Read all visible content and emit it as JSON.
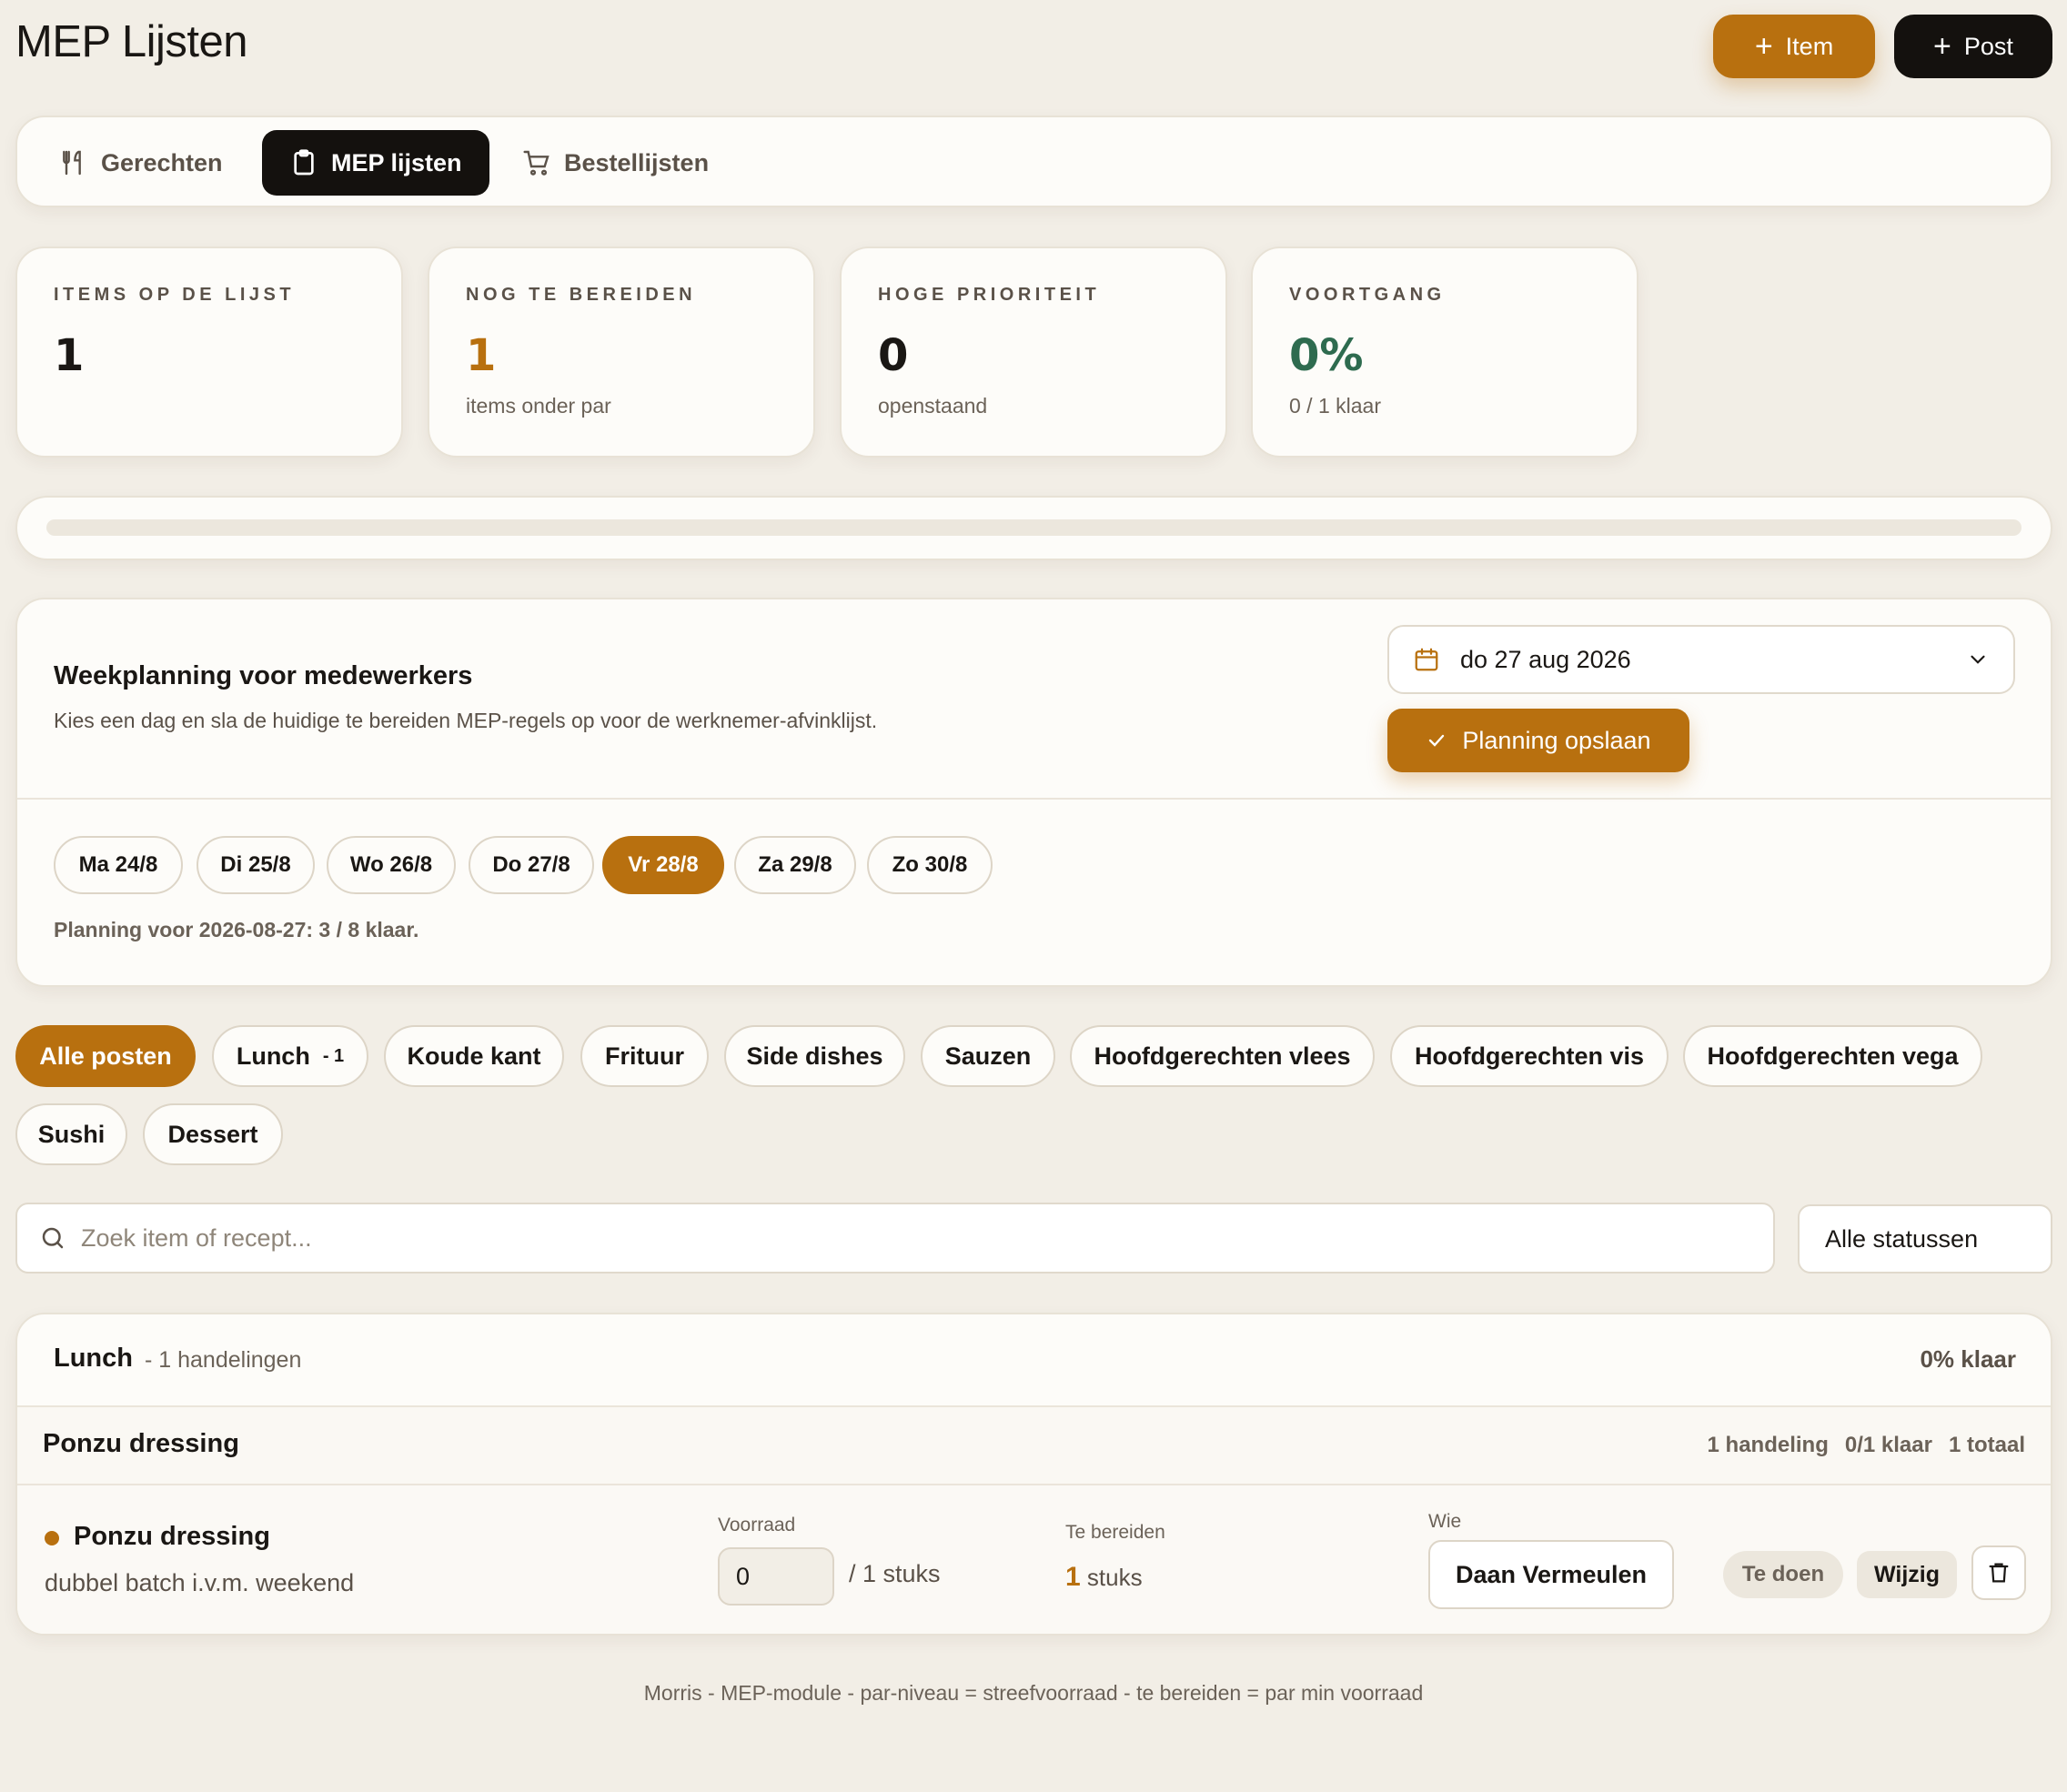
{
  "header": {
    "title": "MEP Lijsten",
    "item_button": "Item",
    "post_button": "Post"
  },
  "tabs": [
    {
      "label": "Gerechten",
      "icon": "utensils-icon",
      "active": false
    },
    {
      "label": "MEP lijsten",
      "icon": "clipboard-icon",
      "active": true
    },
    {
      "label": "Bestellijsten",
      "icon": "cart-icon",
      "active": false
    }
  ],
  "stats": [
    {
      "label": "ITEMS OP DE LIJST",
      "value": "1",
      "sub": "",
      "color": "#1a1714"
    },
    {
      "label": "NOG TE BEREIDEN",
      "value": "1",
      "sub": "items onder par",
      "color": "#b8700f"
    },
    {
      "label": "HOGE PRIORITEIT",
      "value": "0",
      "sub": "openstaand",
      "color": "#1a1714"
    },
    {
      "label": "VOORTGANG",
      "value": "0%",
      "sub": "0 / 1 klaar",
      "color": "#2e6b4f"
    }
  ],
  "progress": {
    "fraction": 0
  },
  "weekplanning": {
    "title": "Weekplanning voor medewerkers",
    "description": "Kies een dag en sla de huidige te bereiden MEP-regels op voor de werknemer-afvinklijst.",
    "selected_date": "do 27 aug 2026",
    "save_button": "Planning opslaan",
    "days": [
      {
        "label": "Ma 24/8",
        "active": false
      },
      {
        "label": "Di 25/8",
        "active": false
      },
      {
        "label": "Wo 26/8",
        "active": false
      },
      {
        "label": "Do 27/8",
        "active": false
      },
      {
        "label": "Vr 28/8",
        "active": true
      },
      {
        "label": "Za 29/8",
        "active": false
      },
      {
        "label": "Zo 30/8",
        "active": false
      }
    ],
    "status": "Planning voor 2026-08-27: 3 / 8 klaar."
  },
  "categories": [
    {
      "label": "Alle posten",
      "count": "",
      "active": true
    },
    {
      "label": "Lunch",
      "count": "- 1",
      "active": false
    },
    {
      "label": "Koude kant",
      "count": "",
      "active": false
    },
    {
      "label": "Frituur",
      "count": "",
      "active": false
    },
    {
      "label": "Side dishes",
      "count": "",
      "active": false
    },
    {
      "label": "Sauzen",
      "count": "",
      "active": false
    },
    {
      "label": "Hoofdgerechten vlees",
      "count": "",
      "active": false
    },
    {
      "label": "Hoofdgerechten vis",
      "count": "",
      "active": false
    },
    {
      "label": "Hoofdgerechten vega",
      "count": "",
      "active": false
    },
    {
      "label": "Sushi",
      "count": "",
      "active": false
    },
    {
      "label": "Dessert",
      "count": "",
      "active": false
    }
  ],
  "search": {
    "placeholder": "Zoek item of recept...",
    "value": ""
  },
  "status_filter": {
    "selected": "Alle statussen"
  },
  "group": {
    "name": "Lunch",
    "meta": "- 1 handelingen",
    "percent": "0% klaar",
    "subgroup": {
      "name": "Ponzu dressing",
      "handeling": "1 handeling",
      "klaar": "0/1 klaar",
      "totaal": "1 totaal"
    },
    "item": {
      "name": "Ponzu dressing",
      "note": "dubbel batch i.v.m. weekend",
      "voorraad_label": "Voorraad",
      "voorraad_value": "0",
      "voorraad_total": "/ 1 stuks",
      "prep_label": "Te bereiden",
      "prep_value": "1",
      "prep_unit": "stuks",
      "who_label": "Wie",
      "who_value": "Daan Vermeulen",
      "status": "Te doen",
      "edit_button": "Wijzig"
    }
  },
  "footer": "Morris - MEP-module - par-niveau = streefvoorraad - te bereiden = par min voorraad",
  "colors": {
    "accent": "#b8700f",
    "dark": "#14110e",
    "success": "#2e6b4f",
    "background": "#f2eee6"
  }
}
